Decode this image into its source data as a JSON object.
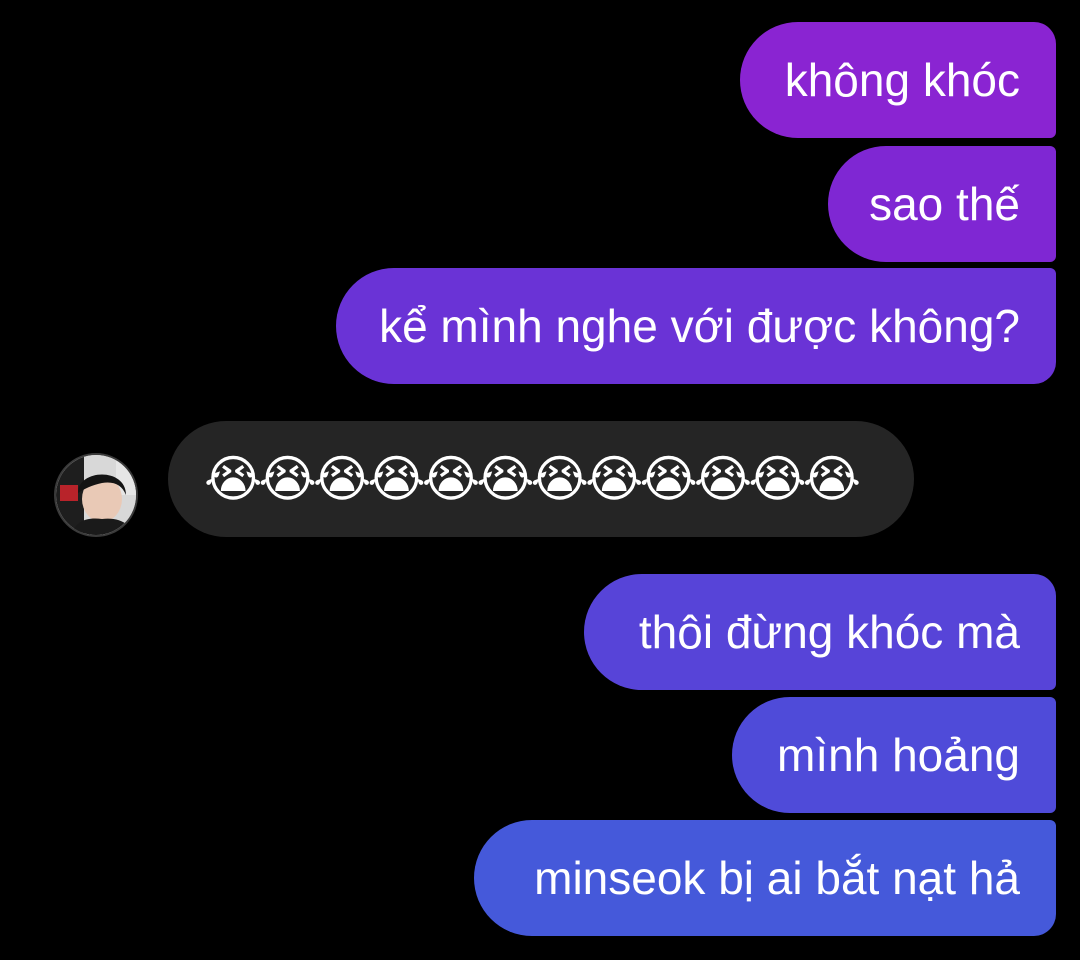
{
  "conversation": {
    "sent_group_1": [
      {
        "text": "không khóc"
      },
      {
        "text": "sao thế"
      },
      {
        "text": "kể mình nghe với được không?"
      }
    ],
    "received": {
      "text": "😭😭😭😭😭😭😭😭😭😭😭😭",
      "emoji_count": 12,
      "avatar_icon": "user-avatar-photo"
    },
    "sent_group_2": [
      {
        "text": "thôi đừng khóc mà"
      },
      {
        "text": "mình hoảng"
      },
      {
        "text": "minseok bị ai bắt nạt hả"
      }
    ]
  },
  "colors": {
    "background": "#000000",
    "received_bubble": "#252525",
    "sent_gradient_top": "#8a24d2",
    "sent_gradient_bottom": "#4559da",
    "text": "#ffffff"
  }
}
